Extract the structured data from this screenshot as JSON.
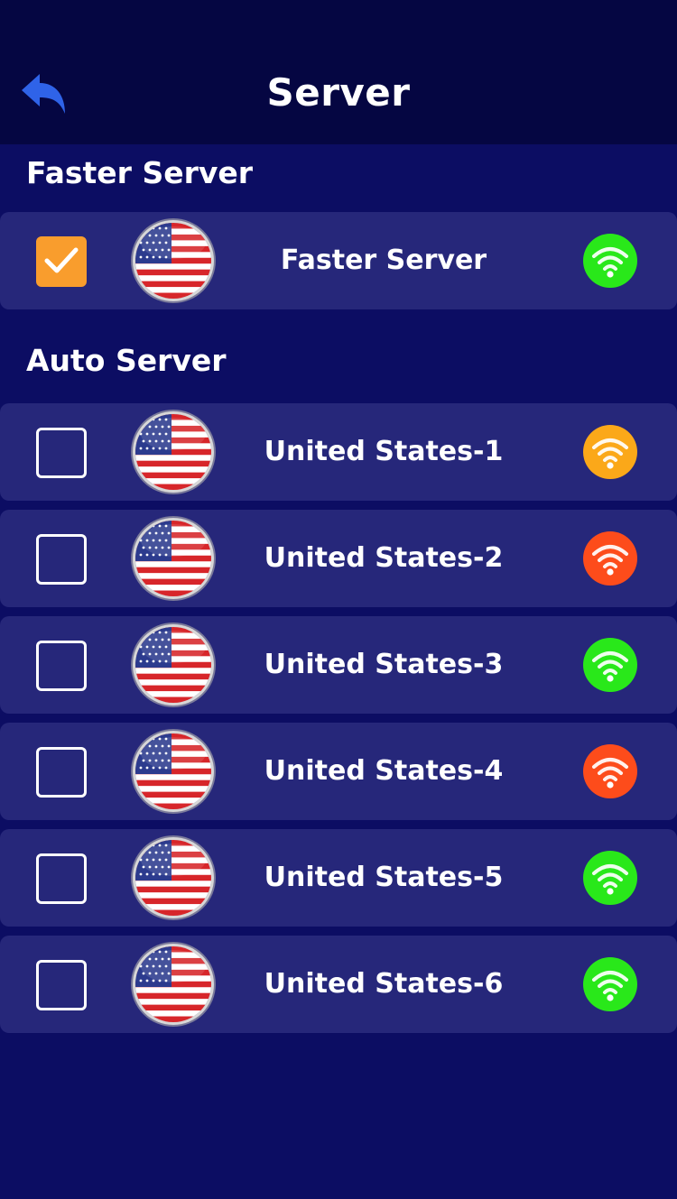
{
  "header": {
    "title": "Server",
    "back_icon": "back-arrow-icon"
  },
  "faster_section": {
    "title": "Faster Server",
    "item": {
      "label": "Faster Server",
      "checked": true,
      "flag": "us-flag-icon",
      "signal_color": "#29e81a"
    }
  },
  "auto_section": {
    "title": "Auto Server",
    "items": [
      {
        "label": "United States-1",
        "checked": false,
        "flag": "us-flag-icon",
        "signal_color": "#fba819"
      },
      {
        "label": "United States-2",
        "checked": false,
        "flag": "us-flag-icon",
        "signal_color": "#fd4c1b"
      },
      {
        "label": "United States-3",
        "checked": false,
        "flag": "us-flag-icon",
        "signal_color": "#29e81a"
      },
      {
        "label": "United States-4",
        "checked": false,
        "flag": "us-flag-icon",
        "signal_color": "#fd4c1b"
      },
      {
        "label": "United States-5",
        "checked": false,
        "flag": "us-flag-icon",
        "signal_color": "#29e81a"
      },
      {
        "label": "United States-6",
        "checked": false,
        "flag": "us-flag-icon",
        "signal_color": "#29e81a"
      }
    ]
  },
  "colors": {
    "background": "#0c0d63",
    "header": "#050642",
    "row": "#26277a",
    "checked": "#f99d2d",
    "back_icon": "#2f63e8"
  }
}
